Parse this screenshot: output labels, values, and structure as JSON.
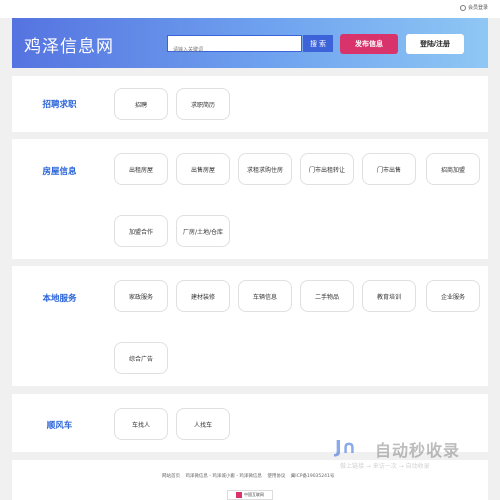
{
  "topbar": {
    "member_link": "会员登录"
  },
  "header": {
    "logo": "鸡泽信息网",
    "search_placeholder": "请输入关键词",
    "search_button": "搜 索",
    "post_button": "发布信息",
    "login_button": "登陆/注册"
  },
  "categories": [
    {
      "title": "招聘求职",
      "tags": [
        "招聘",
        "求职简历"
      ]
    },
    {
      "title": "房屋信息",
      "tags": [
        "出租房屋",
        "出售房屋",
        "求租求购住房",
        "门市出租转让",
        "门市出售",
        "招商加盟",
        "加盟合作",
        "厂房/土地/仓库"
      ]
    },
    {
      "title": "本地服务",
      "tags": [
        "家政服务",
        "建材装修",
        "车辆信息",
        "二手物品",
        "教育培训",
        "企业服务",
        "综合广告"
      ]
    },
    {
      "title": "顺风车",
      "tags": [
        "车找人",
        "人找车"
      ]
    }
  ],
  "footer": {
    "links": [
      "网站首页",
      "鸡泽微信息 - 鸡泽城小搬 - 鸡泽微信息",
      "使用协议",
      "冀ICP备19035241号"
    ],
    "badge": "中国互联网"
  },
  "watermark": {
    "title": "自动秒收录",
    "sub": "做上链接 → 来访一次 → 自动收录"
  }
}
